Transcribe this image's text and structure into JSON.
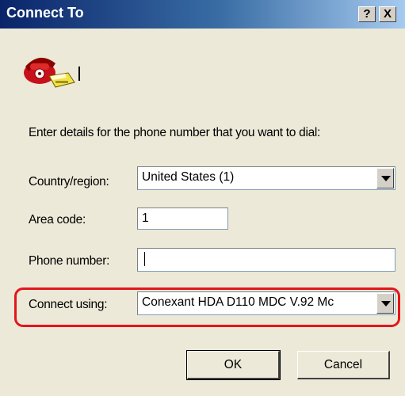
{
  "window": {
    "title": "Connect To",
    "help_label": "?",
    "close_label": "X"
  },
  "prompt": "Enter details for the phone number that you want to dial:",
  "form": {
    "country_label": "Country/region:",
    "country_value": "United States (1)",
    "area_code_label": "Area code:",
    "area_code_value": "1",
    "phone_label": "Phone number:",
    "phone_value": "",
    "connect_using_label": "Connect using:",
    "connect_using_value": "Conexant HDA D110 MDC V.92 Mc"
  },
  "buttons": {
    "ok_label": "OK",
    "cancel_label": "Cancel"
  },
  "colors": {
    "highlight": "#e4161d",
    "title_bar": "#0a246a"
  },
  "icons": {
    "connection": "telephone-icon"
  }
}
